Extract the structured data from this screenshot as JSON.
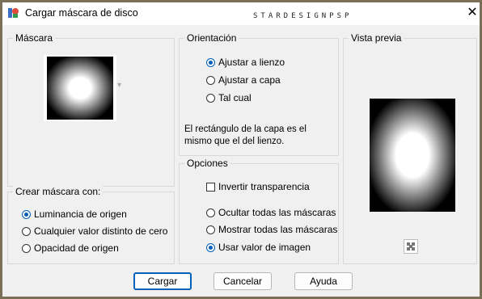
{
  "window": {
    "title": "Cargar máscara de disco",
    "watermark": "STARDESIGNPSP",
    "close_glyph": "✕"
  },
  "mask_group": {
    "title": "Máscara",
    "dropdown_glyph": "▾"
  },
  "create_group": {
    "title": "Crear máscara con:",
    "options": [
      {
        "label": "Luminancia de origen",
        "selected": true
      },
      {
        "label": "Cualquier valor distinto de cero",
        "selected": false
      },
      {
        "label": "Opacidad de origen",
        "selected": false
      }
    ]
  },
  "orientation_group": {
    "title": "Orientación",
    "options": [
      {
        "label": "Ajustar a lienzo",
        "selected": true
      },
      {
        "label": "Ajustar a capa",
        "selected": false
      },
      {
        "label": "Tal cual",
        "selected": false
      }
    ],
    "description_line1": "El rectángulo de la capa es el",
    "description_line2": "mismo que el del lienzo."
  },
  "options_group": {
    "title": "Opciones",
    "invert_label": "Invertir transparencia",
    "invert_checked": false,
    "options": [
      {
        "label": "Ocultar todas las máscaras",
        "selected": false
      },
      {
        "label": "Mostrar todas las máscaras",
        "selected": false
      },
      {
        "label": "Usar valor de imagen",
        "selected": true
      }
    ]
  },
  "preview_group": {
    "title": "Vista previa"
  },
  "buttons": {
    "load": "Cargar",
    "cancel": "Cancelar",
    "help": "Ayuda"
  },
  "colors": {
    "accent": "#005fb8",
    "frame": "#7a7058",
    "panel": "#f0f0f0"
  }
}
